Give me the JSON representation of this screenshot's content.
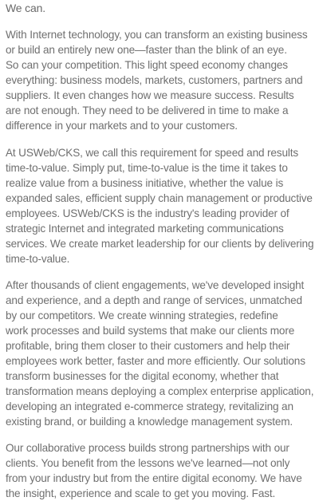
{
  "heading": "We can.",
  "paragraphs": [
    {
      "lines": [
        "With Internet technology, you can transform an existing business",
        "or build an entirely new one—faster than the blink of an eye.",
        "So can your competition. This light speed economy changes",
        "everything: business models, markets, customers, partners and",
        "suppliers. It even changes how we measure success. Results",
        "are not enough. They need to be delivered in time to make a",
        "difference in your markets and to your customers."
      ]
    },
    {
      "lines": [
        "At USWeb/CKS, we call this requirement for speed and results",
        "time-to-value. Simply put, time-to-value is the time it takes to",
        "realize value from a business initiative, whether the value is",
        "expanded sales, efficient supply chain management or productive",
        "employees. USWeb/CKS is the industry's leading provider of",
        "strategic Internet and integrated marketing communications",
        "services. We create market leadership for our clients by delivering",
        "time-to-value."
      ]
    },
    {
      "lines": [
        "After thousands of client engagements, we've developed insight",
        "and experience, and a depth and range of services, unmatched",
        "by our competitors. We create winning strategies, redefine",
        "work processes and build systems that make our clients more",
        "profitable, bring them closer to their customers and help their",
        "employees work better, faster and more efficiently. Our solutions",
        "transform businesses for the digital economy, whether that",
        "transformation means deploying a complex enterprise application,",
        "developing an integrated e-commerce strategy, revitalizing an",
        "existing brand, or building a knowledge management system."
      ]
    },
    {
      "lines": [
        "Our collaborative process builds strong partnerships with our",
        "clients. You benefit from the lessons we've learned—not only",
        "from your industry but from the entire digital economy. We have",
        "the insight, experience and scale to get you moving. Fast."
      ]
    }
  ]
}
